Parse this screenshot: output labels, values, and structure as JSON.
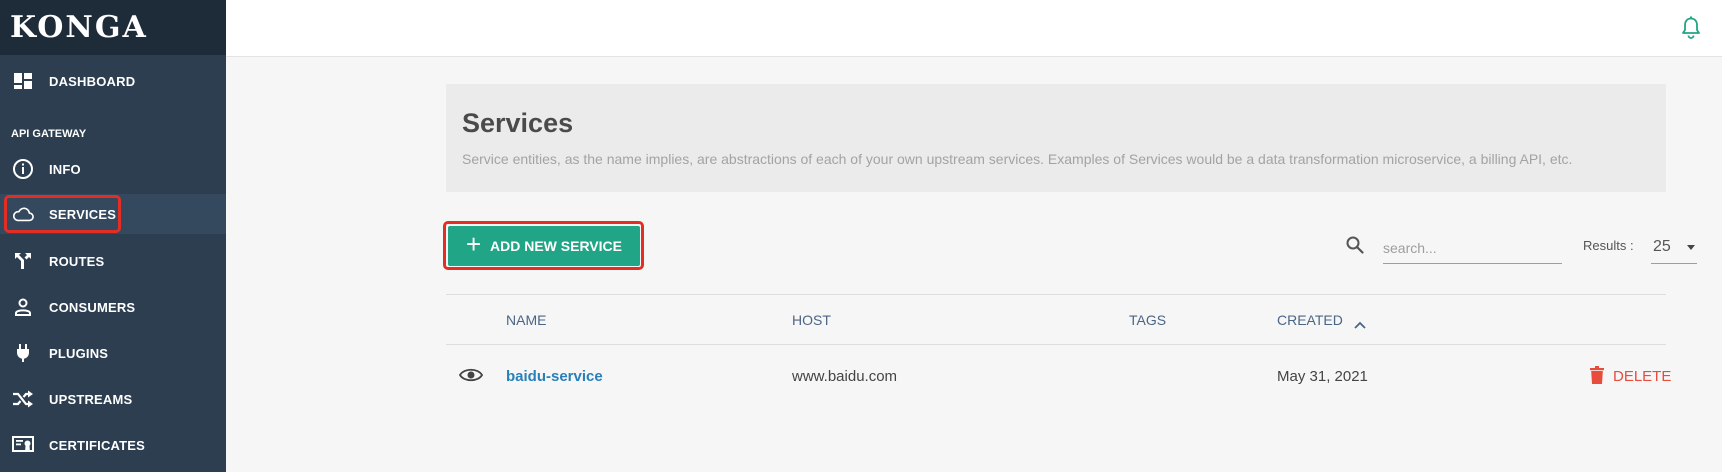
{
  "brand": {
    "name": "KONGA"
  },
  "sidebar": {
    "dashboard_label": "DASHBOARD",
    "section_title": "API GATEWAY",
    "items": [
      {
        "label": "INFO",
        "icon": "info-icon"
      },
      {
        "label": "SERVICES",
        "icon": "cloud-icon"
      },
      {
        "label": "ROUTES",
        "icon": "routes-icon"
      },
      {
        "label": "CONSUMERS",
        "icon": "user-icon"
      },
      {
        "label": "PLUGINS",
        "icon": "plug-icon"
      },
      {
        "label": "UPSTREAMS",
        "icon": "shuffle-icon"
      },
      {
        "label": "CERTIFICATES",
        "icon": "certificate-icon"
      }
    ],
    "active": "SERVICES"
  },
  "topbar": {
    "icon": "bell-icon"
  },
  "header": {
    "title": "Services",
    "description": "Service entities, as the name implies, are abstractions of each of your own upstream services. Examples of Services would be a data transformation microservice, a billing API, etc."
  },
  "toolbar": {
    "add_label": "ADD NEW SERVICE",
    "search_placeholder": "search...",
    "results_label": "Results :",
    "results_value": "25"
  },
  "table": {
    "columns": [
      "NAME",
      "HOST",
      "TAGS",
      "CREATED"
    ],
    "sort": {
      "column": "CREATED",
      "direction": "ascending"
    },
    "rows": [
      {
        "name": "baidu-service",
        "host": "www.baidu.com",
        "tags": "",
        "created": "May 31, 2021",
        "action": "DELETE"
      }
    ]
  },
  "colors": {
    "sidebar_bg": "#2c3e50",
    "accent": "#20a586",
    "link": "#2980b9",
    "danger": "#e74c3c",
    "highlight": "#e32e25"
  }
}
